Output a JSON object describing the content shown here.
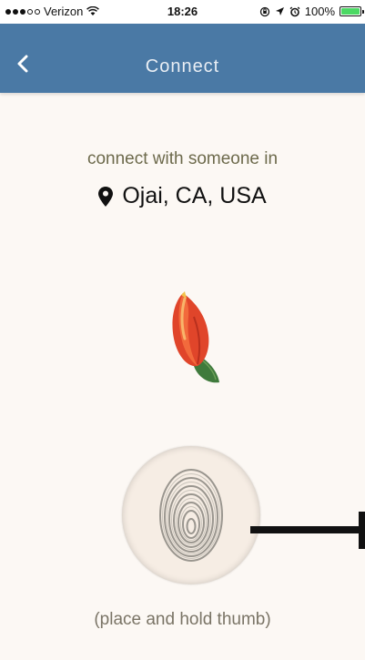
{
  "status_bar": {
    "carrier": "Verizon",
    "time": "18:26",
    "battery": "100%",
    "signal_bars_filled": 3,
    "signal_bars_total": 5,
    "battery_level": 1.0,
    "battery_color": "#4cd964"
  },
  "nav": {
    "title": "Connect",
    "back_icon": "chevron-left-icon",
    "background": "#4a79a5"
  },
  "main": {
    "prompt": "connect with someone in",
    "location": "Ojai, CA, USA",
    "location_icon": "map-pin-icon",
    "hint": "(place and hold thumb)"
  }
}
